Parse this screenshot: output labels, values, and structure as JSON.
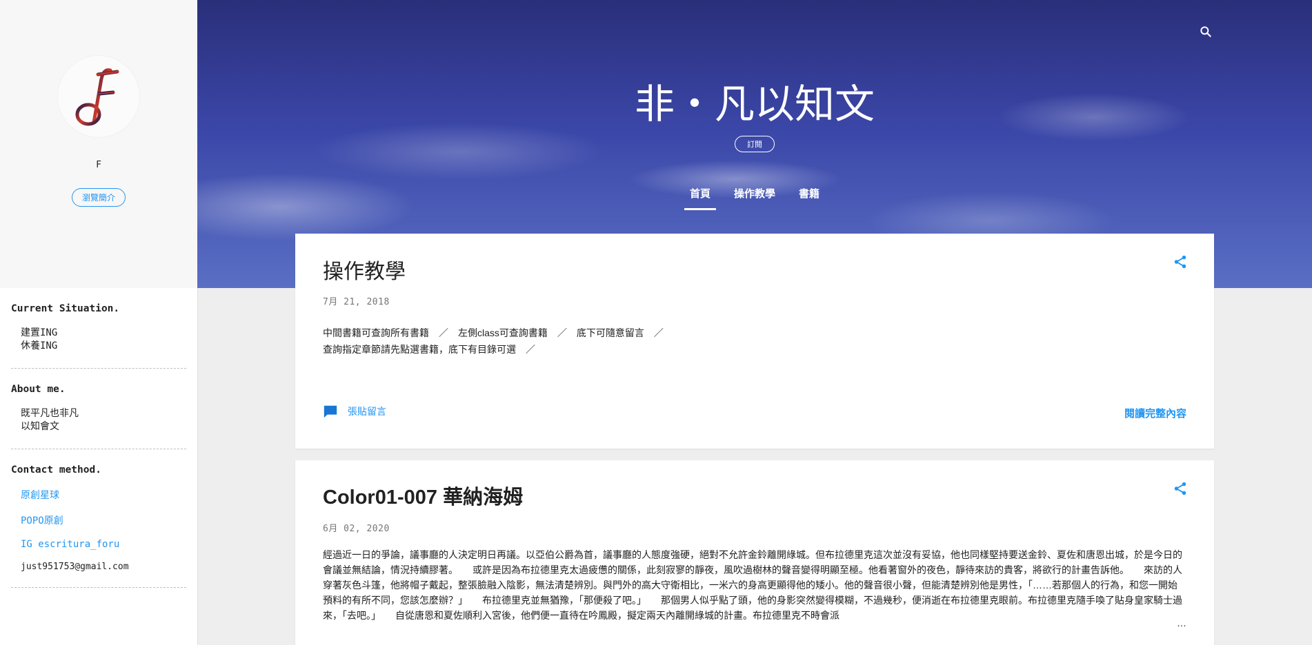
{
  "sidebar": {
    "profile_name": "F",
    "profile_button": "瀏覽簡介",
    "widgets": [
      {
        "title": "Current Situation.",
        "lines": [
          "建置ING",
          "休養ING"
        ]
      },
      {
        "title": "About me.",
        "lines": [
          "既平凡也非凡",
          "以知會文"
        ]
      },
      {
        "title": "Contact method.",
        "links": [
          "原創星球",
          "POPO原創",
          "IG escritura_foru"
        ],
        "email": "just951753@gmail.com"
      }
    ]
  },
  "header": {
    "blog_title": "非‧凡以知文",
    "subscribe": "訂閱",
    "nav": [
      "首頁",
      "操作教學",
      "書籍"
    ],
    "active_tab": "首頁"
  },
  "posts": [
    {
      "title": "操作教學",
      "date": "7月 21, 2018",
      "snippet_lines": [
        "中間書籍可查詢所有書籍　／　左側class可查詢書籍　／　底下可隨意留言　／",
        "查詢指定章節請先點選書籍，底下有目錄可選　／"
      ],
      "comments_label": "張貼留言",
      "read_more": "閱讀完整內容"
    },
    {
      "title": "Color01-007 華納海姆",
      "date": "6月 02, 2020",
      "snippet": "經過近一日的爭論，議事廳的人決定明日再議。以亞伯公爵為首，議事廳的人態度強硬，絕對不允許金鈴離開綠城。但布拉德里克這次並沒有妥協，他也同樣堅持要送金鈴、夏佐和唐恩出城，於是今日的會議並無結論，情況持續膠著。　　或許是因為布拉德里克太過疲憊的關係，此刻寂寥的靜夜，風吹過樹林的聲音變得明顯至極。他看著窗外的夜色，靜待來訪的貴客，將欲行的計畫告訴他。　　來訪的人穿著灰色斗篷，他將帽子戴起，整張臉融入陰影，無法清楚辨別。與門外的高大守衛相比，一米六的身高更顯得他的矮小。他的聲音很小聲，但能清楚辨別他是男性，「……若那個人的行為，和您一開始預料的有所不同，您該怎麼辦？」　　布拉德里克並無猶豫，「那便殺了吧。」　　那個男人似乎點了頭，他的身影突然變得模糊，不過幾秒，便消逝在布拉德里克眼前。布拉德里克隨手喚了貼身皇家騎士過來，「去吧。」　　自從唐恩和夏佐順利入宮後，他們便一直待在吟鳳殿，擬定兩天內離開綠城的計畫。布拉德里克不時會派",
      "ellipsis": "…"
    }
  ],
  "colors": {
    "accent": "#2196f3",
    "sidebar_bg": "#f7f7f7",
    "page_bg": "#eeeeee"
  }
}
